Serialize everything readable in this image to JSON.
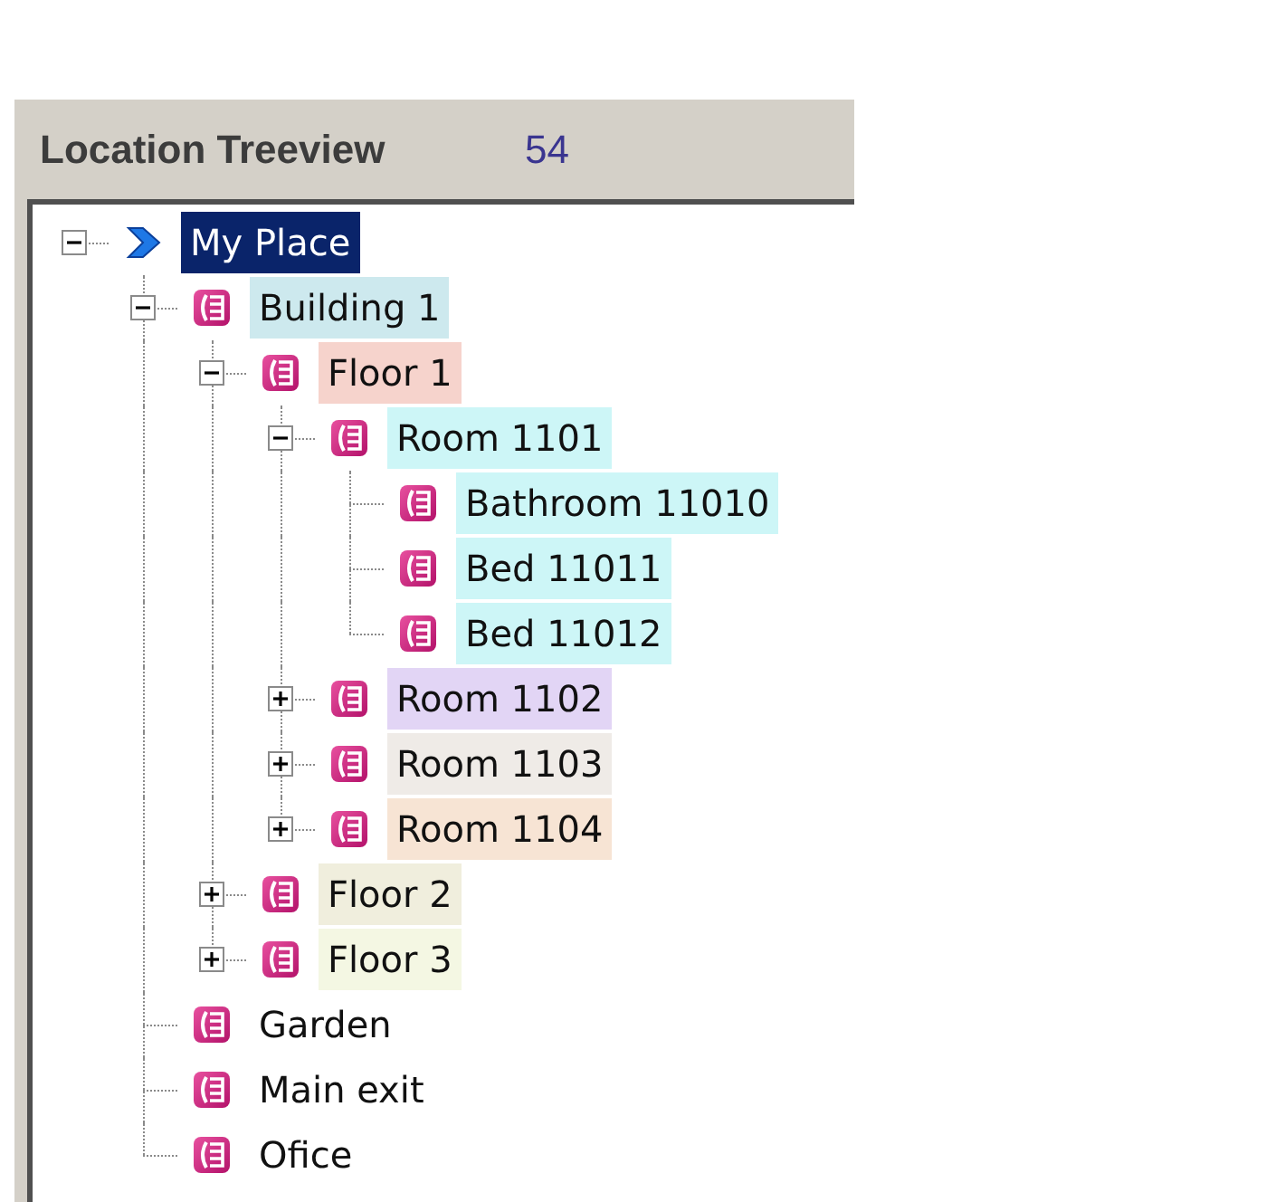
{
  "panel": {
    "title": "Location Treeview",
    "count": "54"
  },
  "tree": [
    {
      "label": "My Place",
      "kind": "root",
      "selected": true,
      "expanded": true,
      "children": [
        {
          "label": "Building 1",
          "kind": "location",
          "selected": false,
          "color": "#cde9ee",
          "expanded": true,
          "children": [
            {
              "label": "Floor 1",
              "kind": "location",
              "selected": false,
              "color": "#f6d3cc",
              "expanded": true,
              "children": [
                {
                  "label": "Room 1101",
                  "kind": "location",
                  "selected": false,
                  "color": "#cdf6f7",
                  "expanded": true,
                  "children": [
                    {
                      "label": "Bathroom 11010",
                      "kind": "location",
                      "selected": false,
                      "color": "#cdf6f7"
                    },
                    {
                      "label": "Bed 11011",
                      "kind": "location",
                      "selected": false,
                      "color": "#cdf6f7"
                    },
                    {
                      "label": "Bed 11012",
                      "kind": "location",
                      "selected": false,
                      "color": "#cdf6f7"
                    }
                  ]
                },
                {
                  "label": "Room 1102",
                  "kind": "location",
                  "selected": false,
                  "color": "#e2d5f5",
                  "expanded": false
                },
                {
                  "label": "Room 1103",
                  "kind": "location",
                  "selected": false,
                  "color": "#efebe7",
                  "expanded": false
                },
                {
                  "label": "Room 1104",
                  "kind": "location",
                  "selected": false,
                  "color": "#f7e4d4",
                  "expanded": false
                }
              ]
            },
            {
              "label": "Floor 2",
              "kind": "location",
              "selected": false,
              "color": "#f0eedd",
              "expanded": false
            },
            {
              "label": "Floor 3",
              "kind": "location",
              "selected": false,
              "color": "#f4f7e3",
              "expanded": false
            }
          ]
        },
        {
          "label": "Garden",
          "kind": "location",
          "selected": false
        },
        {
          "label": "Main exit",
          "kind": "location",
          "selected": false
        },
        {
          "label": "Ofice",
          "kind": "location",
          "selected": false
        }
      ]
    }
  ]
}
